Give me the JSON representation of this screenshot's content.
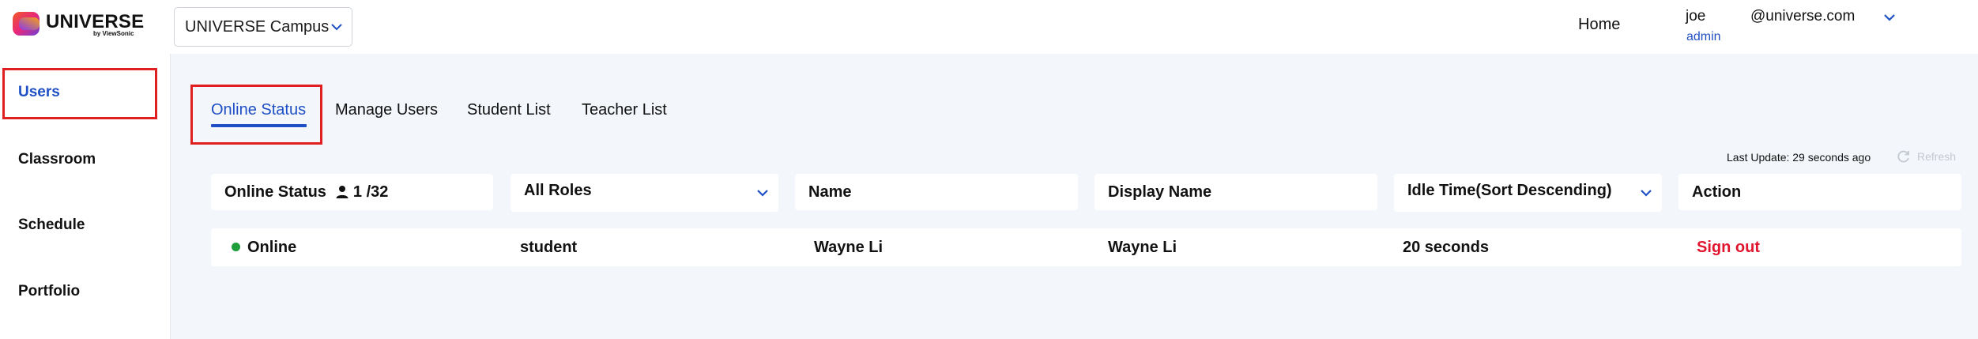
{
  "brand": {
    "name": "UNIVERSE",
    "sub": "by ViewSonic"
  },
  "campus_select": {
    "value": "UNIVERSE Campus"
  },
  "header_nav": {
    "home": "Home"
  },
  "user": {
    "name": "joe",
    "role": "admin",
    "email": "@universe.com"
  },
  "sidebar": {
    "items": [
      {
        "label": "Users",
        "active": true
      },
      {
        "label": "Classroom",
        "active": false
      },
      {
        "label": "Schedule",
        "active": false
      },
      {
        "label": "Portfolio",
        "active": false
      }
    ]
  },
  "tabs": [
    {
      "label": "Online Status",
      "active": true
    },
    {
      "label": "Manage Users",
      "active": false
    },
    {
      "label": "Student List",
      "active": false
    },
    {
      "label": "Teacher List",
      "active": false
    }
  ],
  "last_update": "Last Update: 29 seconds ago",
  "refresh_label": "Refresh",
  "table": {
    "online_status_header": "Online Status",
    "online_count": "1 /32",
    "roles_filter": "All Roles",
    "name_header": "Name",
    "display_name_header": "Display Name",
    "idle_time_filter": "Idle Time(Sort Descending)",
    "action_header": "Action",
    "rows": [
      {
        "status": "Online",
        "role": "student",
        "name": "Wayne Li",
        "display_name": "Wayne Li",
        "idle_time": "20 seconds",
        "action": "Sign out"
      }
    ]
  },
  "colors": {
    "accent": "#1f4fc4",
    "highlight": "#e02020",
    "online": "#1e9e3a",
    "danger": "#e0142d",
    "page_bg": "#f3f6fb"
  }
}
